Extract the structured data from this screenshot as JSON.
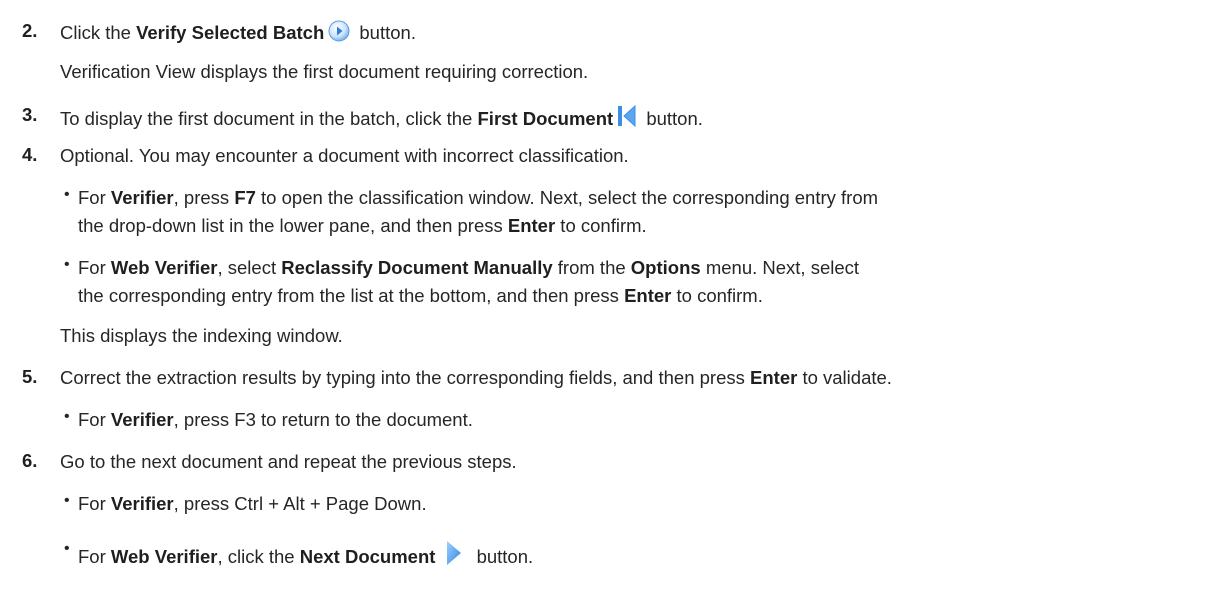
{
  "steps": {
    "s2": {
      "num": "2.",
      "a": "Click the ",
      "b": "Verify Selected Batch",
      "c": " button.",
      "sub": "Verification View displays the first document requiring correction."
    },
    "s3": {
      "num": "3.",
      "a": "To display the first document in the batch, click the ",
      "b": "First Document",
      "c": " button."
    },
    "s4": {
      "num": "4.",
      "text": "Optional. You may encounter a document with incorrect classification.",
      "b1": {
        "a": "For ",
        "b": "Verifier",
        "c": ", press ",
        "d": "F7",
        "e": " to open the classification window. Next, select the corresponding entry from",
        "line2a": "the drop-down list in the lower pane, and then press ",
        "line2b": "Enter",
        "line2c": " to confirm."
      },
      "b2": {
        "a": "For ",
        "b": "Web Verifier",
        "c": ", select ",
        "d": "Reclassify Document Manually",
        "e": " from the ",
        "f": "Options",
        "g": " menu. Next, select",
        "line2a": "the corresponding entry from the list at the bottom, and then press ",
        "line2b": "Enter",
        "line2c": " to confirm."
      },
      "sub": "This displays the indexing window."
    },
    "s5": {
      "num": "5.",
      "a": "Correct the extraction results by typing into the corresponding fields, and then press ",
      "b": "Enter",
      "c": " to validate.",
      "b1": {
        "a": "For ",
        "b": "Verifier",
        "c": ", press F3 to return to the document."
      }
    },
    "s6": {
      "num": "6.",
      "text": "Go to the next document and repeat the previous steps.",
      "b1": {
        "a": "For ",
        "b": "Verifier",
        "c": ", press Ctrl + Alt + Page Down."
      },
      "b2": {
        "a": "For ",
        "b": "Web Verifier",
        "c": ", click the ",
        "d": "Next Document",
        "e": " button."
      }
    }
  },
  "icons": {
    "verify_batch": "play-circle-icon",
    "first_document": "skip-to-first-icon",
    "next_document": "next-arrow-icon"
  },
  "colors": {
    "icon_blue": "#3a8ee6",
    "text": "#262626"
  }
}
